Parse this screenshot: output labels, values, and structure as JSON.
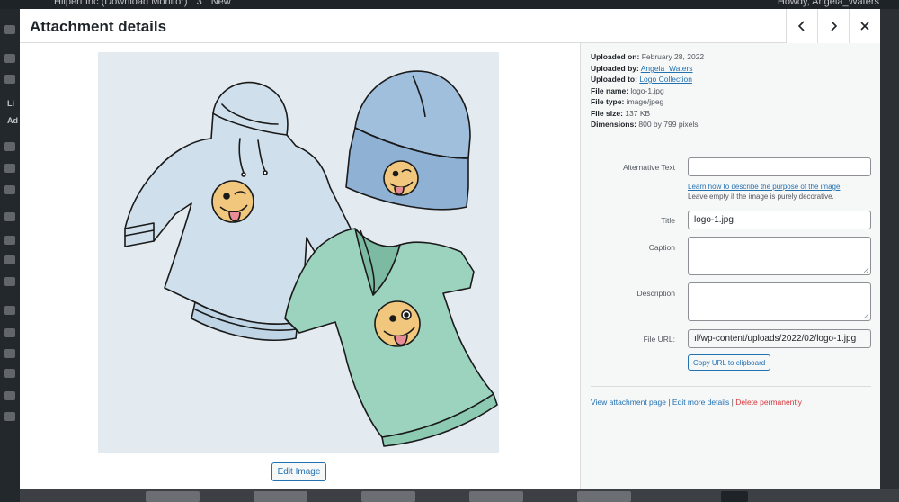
{
  "adminbar": {
    "site_name": "Hilpert Inc (Download Monitor)",
    "comments_count": "3",
    "new_label": "New",
    "howdy": "Howdy, Angela_Waters"
  },
  "adminmenu": {
    "labels": [
      "Li",
      "Ad"
    ]
  },
  "modal": {
    "title": "Attachment details",
    "prev_icon": "chevron-left-icon",
    "next_icon": "chevron-right-icon",
    "close_icon": "close-icon"
  },
  "media": {
    "edit_image_label": "Edit Image"
  },
  "details": {
    "uploaded_on_label": "Uploaded on:",
    "uploaded_on": "February 28, 2022",
    "uploaded_by_label": "Uploaded by:",
    "uploaded_by": "Angela_Waters",
    "uploaded_to_label": "Uploaded to:",
    "uploaded_to": "Logo Collection",
    "file_name_label": "File name:",
    "file_name": "logo-1.jpg",
    "file_type_label": "File type:",
    "file_type": "image/jpeg",
    "file_size_label": "File size:",
    "file_size": "137 KB",
    "dimensions_label": "Dimensions:",
    "dimensions": "800 by 799 pixels"
  },
  "form": {
    "alt_label": "Alternative Text",
    "alt_value": "",
    "alt_help_link": "Learn how to describe the purpose of the image",
    "alt_help_text": "Leave empty if the image is purely decorative.",
    "title_label": "Title",
    "title_value": "logo-1.jpg",
    "caption_label": "Caption",
    "description_label": "Description",
    "file_url_label": "File URL:",
    "file_url_value": "ıl/wp-content/uploads/2022/02/logo-1.jpg",
    "copy_url_label": "Copy URL to clipboard"
  },
  "actions": {
    "view": "View attachment page",
    "edit_more": "Edit more details",
    "delete": "Delete permanently"
  }
}
